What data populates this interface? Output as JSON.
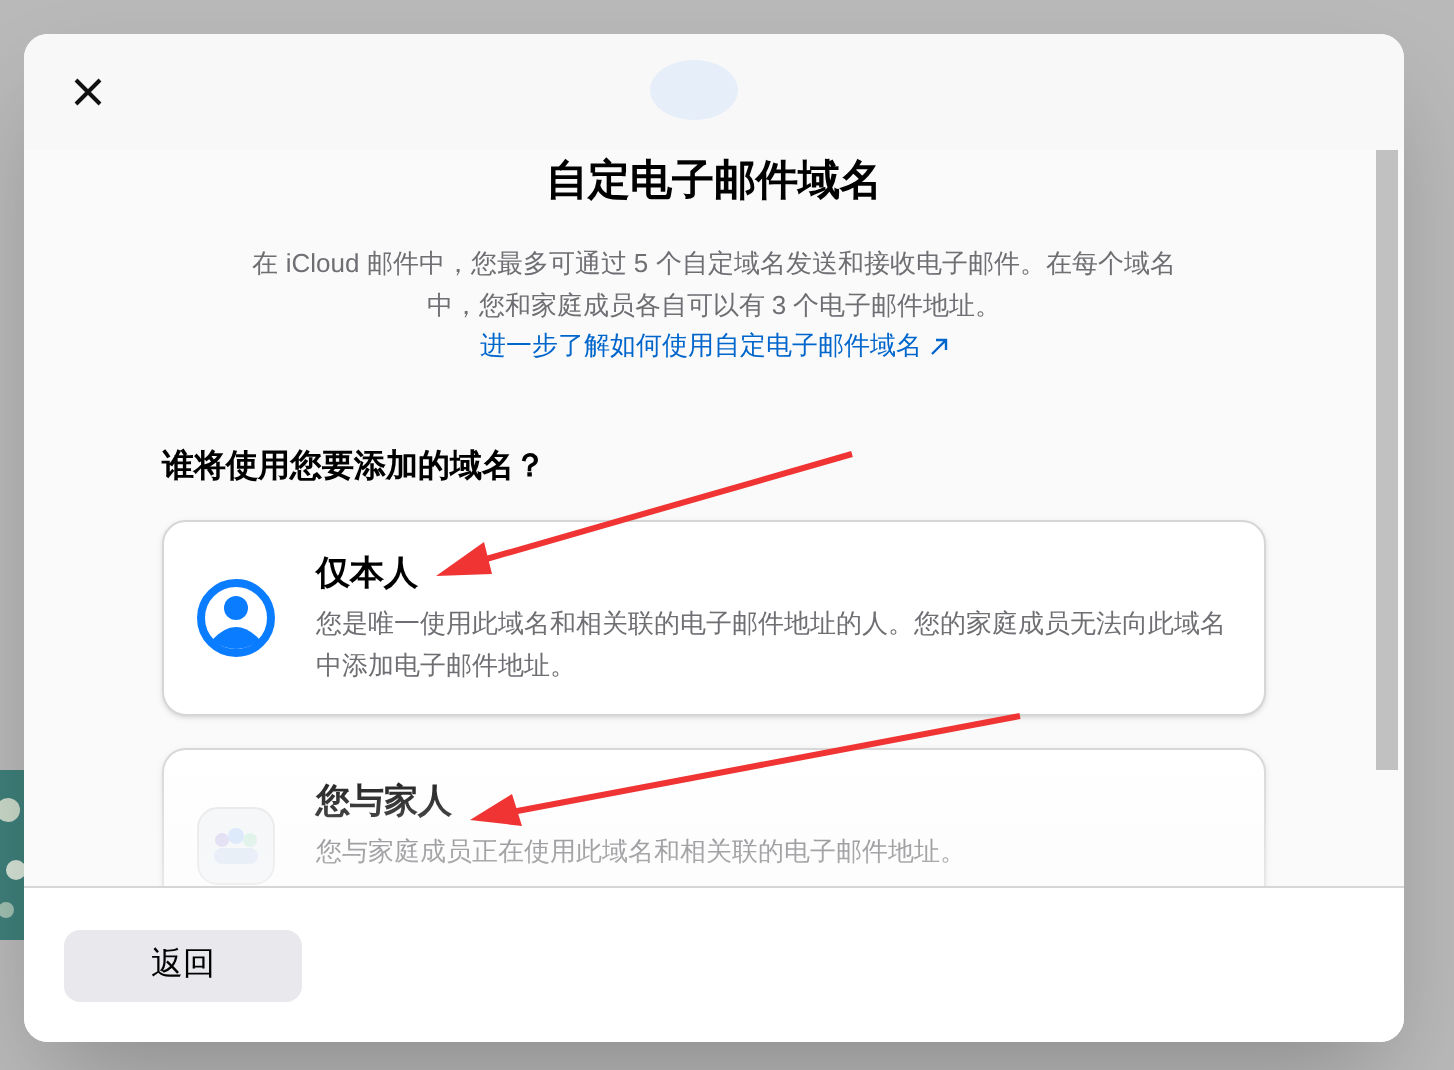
{
  "dialog": {
    "title": "自定电子邮件域名",
    "description": "在 iCloud 邮件中，您最多可通过 5 个自定域名发送和接收电子邮件。在每个域名中，您和家庭成员各自可以有 3 个电子邮件地址。",
    "link": "进一步了解如何使用自定电子邮件域名",
    "question": "谁将使用您要添加的域名？",
    "options": [
      {
        "kind": "person",
        "title": "仅本人",
        "description": "您是唯一使用此域名和相关联的电子邮件地址的人。您的家庭成员无法向此域名中添加电子邮件地址。"
      },
      {
        "kind": "family",
        "title": "您与家人",
        "description": "您与家庭成员正在使用此域名和相关联的电子邮件地址。"
      }
    ],
    "back_button": "返回"
  }
}
